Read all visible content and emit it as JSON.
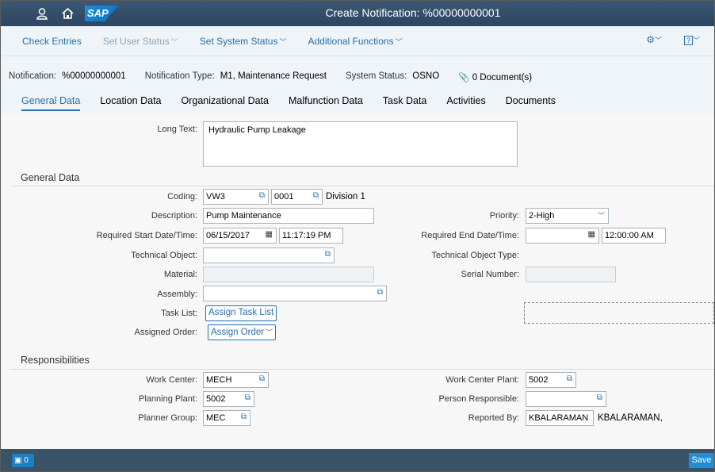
{
  "shell": {
    "title": "Create Notification: %00000000001",
    "logo": "SAP",
    "icons": [
      "user-icon",
      "home-icon"
    ]
  },
  "toolbar": {
    "check_entries": "Check Entries",
    "set_user_status": "Set User Status",
    "set_system_status": "Set System Status",
    "additional_functions": "Additional Functions",
    "right_icons": [
      "settings-icon",
      "help-icon"
    ]
  },
  "header": {
    "notification_label": "Notification:",
    "notification_value": "%00000000001",
    "type_label": "Notification Type:",
    "type_value": "M1, Maintenance Request",
    "status_label": "System Status:",
    "status_value": "OSNO",
    "documents": "0 Document(s)"
  },
  "tabs": [
    "General Data",
    "Location Data",
    "Organizational Data",
    "Malfunction Data",
    "Task Data",
    "Activities",
    "Documents"
  ],
  "form": {
    "long_text_label": "Long Text:",
    "long_text_value": "Hydraulic Pump Leakage",
    "general_section": "General Data",
    "coding_label": "Coding:",
    "coding_value1": "VW3",
    "coding_value2": "0001",
    "coding_desc": "Division 1",
    "description_label": "Description:",
    "description_value": "Pump Maintenance",
    "priority_label": "Priority:",
    "priority_value": "2-High",
    "req_start_label": "Required Start Date/Time:",
    "req_start_date": "06/15/2017",
    "req_start_time": "11:17:19 PM",
    "req_end_label": "Required End Date/Time:",
    "req_end_date": "",
    "req_end_time": "12:00:00 AM",
    "tech_object_label": "Technical Object:",
    "tech_object_value": "",
    "tech_object_type_label": "Technical Object Type:",
    "material_label": "Material:",
    "material_value": "",
    "serial_label": "Serial Number:",
    "serial_value": "",
    "assembly_label": "Assembly:",
    "assembly_value": "",
    "task_list_label": "Task List:",
    "task_list_button": "Assign Task List",
    "assigned_order_label": "Assigned Order:",
    "assigned_order_button": "Assign Order",
    "resp_section": "Responsibilities",
    "work_center_label": "Work Center:",
    "work_center_value": "MECH",
    "work_center_plant_label": "Work Center Plant:",
    "work_center_plant_value": "5002",
    "planning_plant_label": "Planning Plant:",
    "planning_plant_value": "5002",
    "person_resp_label": "Person Responsible:",
    "person_resp_value": "",
    "planner_group_label": "Planner Group:",
    "planner_group_value": "MEC",
    "reported_by_label": "Reported By:",
    "reported_by_value": "KBALARAMAN",
    "reported_by_name": "KBALARAMAN,"
  },
  "footer": {
    "messages_count": "0",
    "save": "Save"
  }
}
